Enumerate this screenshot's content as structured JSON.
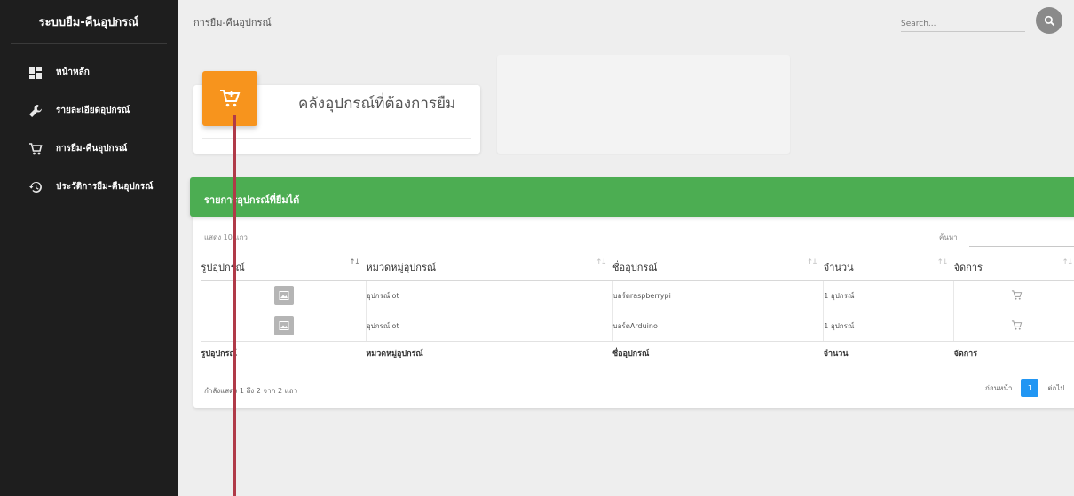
{
  "app": {
    "title": "ระบบยืม-คืนอุปกรณ์"
  },
  "sidebar": {
    "items": [
      {
        "label": "หน้าหลัก",
        "icon": "dashboard-icon"
      },
      {
        "label": "รายละเอียดอุปกรณ์",
        "icon": "wrench-icon"
      },
      {
        "label": "การยืม-คืนอุปกรณ์",
        "icon": "cart-icon"
      },
      {
        "label": "ประวัติการยืม-คืนอุปกรณ์",
        "icon": "history-icon"
      }
    ]
  },
  "header": {
    "page_title": "การยืม-คืนอุปกรณ์",
    "search_placeholder": "Search..."
  },
  "stat_card": {
    "title": "คลังอุปกรณ์ที่ต้องการยืม",
    "icon": "cart-icon",
    "color": "#f7941d"
  },
  "table_card": {
    "header": "รายการอุปกรณ์ที่ยืมได้",
    "header_color": "#4cad52",
    "show_label": "แสดง 10 แถว",
    "find_label": "ค้นหา",
    "columns": [
      "รูปอุปกรณ์",
      "หมวดหมู่อุปกรณ์",
      "ชื่ออุปกรณ์",
      "จำนวน",
      "จัดการ"
    ],
    "rows": [
      {
        "category": "อุปกรณ์iot",
        "name": "บอร์ดraspberrypi",
        "qty": "1 อุปกรณ์"
      },
      {
        "category": "อุปกรณ์iot",
        "name": "บอร์ดArduino",
        "qty": "1 อุปกรณ์"
      }
    ],
    "info": "กำลังแสดง 1 ถึง 2 จาก 2 แถว",
    "pager": {
      "prev": "ก่อนหน้า",
      "current": "1",
      "next": "ต่อไป",
      "color": "#2196f3"
    }
  }
}
